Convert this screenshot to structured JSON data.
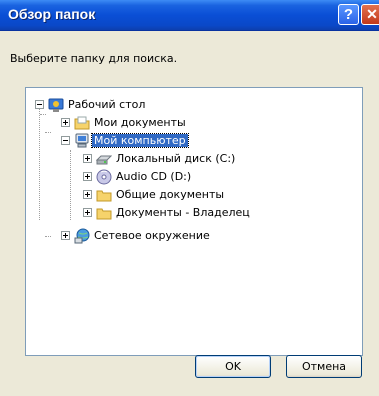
{
  "dialog": {
    "title": "Обзор папок",
    "help_label": "?",
    "close_label": "✕"
  },
  "prompt": "Выберите папку для поиска.",
  "tree": {
    "items": [
      {
        "label": "Рабочий стол",
        "icon": "desktop-icon",
        "expander": "minus"
      },
      {
        "label": "Мои документы",
        "icon": "my-documents-icon",
        "expander": "plus"
      },
      {
        "label": "Мой компьютер",
        "icon": "my-computer-icon",
        "expander": "minus",
        "selected": true
      },
      {
        "label": "Локальный диск (C:)",
        "icon": "hard-drive-icon",
        "expander": "plus"
      },
      {
        "label": "Audio CD (D:)",
        "icon": "cd-drive-icon",
        "expander": "plus"
      },
      {
        "label": "Общие документы",
        "icon": "folder-icon",
        "expander": "plus"
      },
      {
        "label": "Документы - Владелец",
        "icon": "folder-icon",
        "expander": "plus"
      },
      {
        "label": "Сетевое окружение",
        "icon": "network-icon",
        "expander": "plus"
      }
    ]
  },
  "buttons": {
    "ok": "OK",
    "cancel": "Отмена"
  },
  "colors": {
    "titlebar": "#0a4fd6",
    "selection": "#316ac5",
    "dialog_bg": "#ece9d8"
  }
}
